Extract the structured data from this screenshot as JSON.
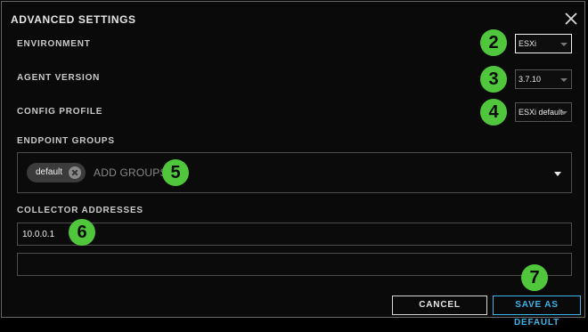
{
  "dialog": {
    "title": "ADVANCED SETTINGS",
    "close_icon": "close-icon"
  },
  "environment": {
    "label": "ENVIRONMENT",
    "value": "ESXi",
    "badge": "2"
  },
  "agent_version": {
    "label": "AGENT VERSION",
    "value": "3.7.10",
    "badge": "3"
  },
  "config_profile": {
    "label": "CONFIG PROFILE",
    "value": "ESXi default",
    "badge": "4"
  },
  "endpoint_groups": {
    "label": "ENDPOINT GROUPS",
    "chips": [
      "default"
    ],
    "placeholder": "ADD GROUPS",
    "badge": "5"
  },
  "collector_addresses": {
    "label": "COLLECTOR ADDRESSES",
    "values": [
      "10.0.0.1",
      ""
    ],
    "badge": "6"
  },
  "footer": {
    "cancel_label": "CANCEL",
    "save_label": "SAVE AS DEFAULT",
    "badge": "7"
  },
  "colors": {
    "badge": "#4fc63c",
    "accent": "#3db4ea",
    "background": "#0a0a0a"
  }
}
